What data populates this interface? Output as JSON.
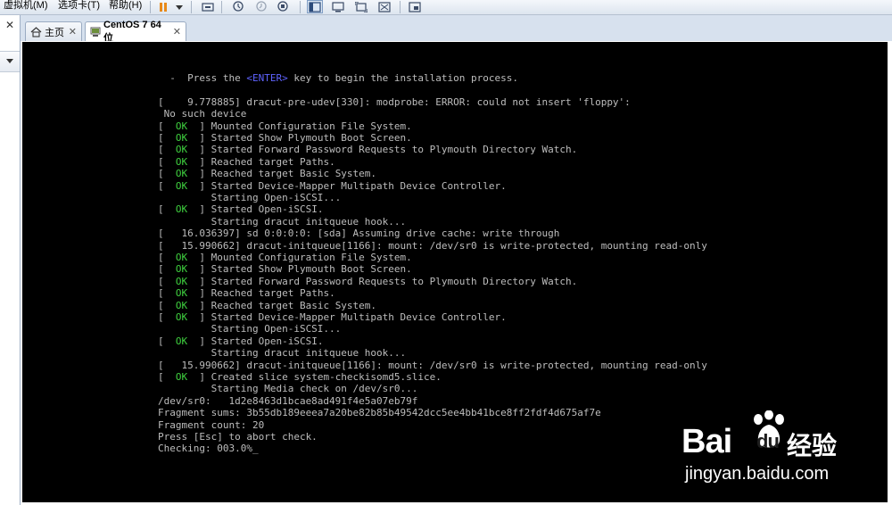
{
  "menu": {
    "items": [
      {
        "label": "虚拟机(M)"
      },
      {
        "label": "选项卡(T)"
      },
      {
        "label": "帮助(H)"
      }
    ]
  },
  "toolbar": {
    "icons": [
      "pause-icon",
      "dropdown-arrow-icon",
      "send-ctrl-alt-del-icon",
      "snapshot-take-icon",
      "snapshot-revert-icon",
      "snapshot-manager-icon",
      "view-sidebar-icon",
      "view-console-icon",
      "fullscreen-icon",
      "unity-icon",
      "thumbnail-icon"
    ]
  },
  "left_panel": {
    "close_glyph": "✕"
  },
  "tabs": [
    {
      "label": "主页",
      "icon": "home-icon",
      "close": "✕",
      "active": false
    },
    {
      "label": "CentOS 7 64 位",
      "icon": "vm-icon",
      "close": "✕",
      "active": true
    }
  ],
  "console": {
    "lines": [
      {
        "segments": [
          {
            "t": "  -  Press the "
          },
          {
            "t": "<ENTER>",
            "c": "enter"
          },
          {
            "t": " key to begin the installation process."
          }
        ]
      },
      {
        "segments": [
          {
            "t": ""
          }
        ]
      },
      {
        "segments": [
          {
            "t": "[    9.778885] dracut-pre-udev[330]: modprobe: ERROR: could not insert 'floppy':"
          }
        ]
      },
      {
        "segments": [
          {
            "t": " No such device"
          }
        ]
      },
      {
        "segments": [
          {
            "t": "[  "
          },
          {
            "t": "OK",
            "c": "ok"
          },
          {
            "t": "  ] Mounted Configuration File System."
          }
        ]
      },
      {
        "segments": [
          {
            "t": "[  "
          },
          {
            "t": "OK",
            "c": "ok"
          },
          {
            "t": "  ] Started Show Plymouth Boot Screen."
          }
        ]
      },
      {
        "segments": [
          {
            "t": "[  "
          },
          {
            "t": "OK",
            "c": "ok"
          },
          {
            "t": "  ] Started Forward Password Requests to Plymouth Directory Watch."
          }
        ]
      },
      {
        "segments": [
          {
            "t": "[  "
          },
          {
            "t": "OK",
            "c": "ok"
          },
          {
            "t": "  ] Reached target Paths."
          }
        ]
      },
      {
        "segments": [
          {
            "t": "[  "
          },
          {
            "t": "OK",
            "c": "ok"
          },
          {
            "t": "  ] Reached target Basic System."
          }
        ]
      },
      {
        "segments": [
          {
            "t": "[  "
          },
          {
            "t": "OK",
            "c": "ok"
          },
          {
            "t": "  ] Started Device-Mapper Multipath Device Controller."
          }
        ]
      },
      {
        "segments": [
          {
            "t": "         Starting Open-iSCSI..."
          }
        ]
      },
      {
        "segments": [
          {
            "t": "[  "
          },
          {
            "t": "OK",
            "c": "ok"
          },
          {
            "t": "  ] Started Open-iSCSI."
          }
        ]
      },
      {
        "segments": [
          {
            "t": "         Starting dracut initqueue hook..."
          }
        ]
      },
      {
        "segments": [
          {
            "t": "[   16.036397] sd 0:0:0:0: [sda] Assuming drive cache: write through"
          }
        ]
      },
      {
        "segments": [
          {
            "t": "[   15.990662] dracut-initqueue[1166]: mount: /dev/sr0 is write-protected, mounting read-only"
          }
        ]
      },
      {
        "segments": [
          {
            "t": "[  "
          },
          {
            "t": "OK",
            "c": "ok"
          },
          {
            "t": "  ] Mounted Configuration File System."
          }
        ]
      },
      {
        "segments": [
          {
            "t": "[  "
          },
          {
            "t": "OK",
            "c": "ok"
          },
          {
            "t": "  ] Started Show Plymouth Boot Screen."
          }
        ]
      },
      {
        "segments": [
          {
            "t": "[  "
          },
          {
            "t": "OK",
            "c": "ok"
          },
          {
            "t": "  ] Started Forward Password Requests to Plymouth Directory Watch."
          }
        ]
      },
      {
        "segments": [
          {
            "t": "[  "
          },
          {
            "t": "OK",
            "c": "ok"
          },
          {
            "t": "  ] Reached target Paths."
          }
        ]
      },
      {
        "segments": [
          {
            "t": "[  "
          },
          {
            "t": "OK",
            "c": "ok"
          },
          {
            "t": "  ] Reached target Basic System."
          }
        ]
      },
      {
        "segments": [
          {
            "t": "[  "
          },
          {
            "t": "OK",
            "c": "ok"
          },
          {
            "t": "  ] Started Device-Mapper Multipath Device Controller."
          }
        ]
      },
      {
        "segments": [
          {
            "t": "         Starting Open-iSCSI..."
          }
        ]
      },
      {
        "segments": [
          {
            "t": "[  "
          },
          {
            "t": "OK",
            "c": "ok"
          },
          {
            "t": "  ] Started Open-iSCSI."
          }
        ]
      },
      {
        "segments": [
          {
            "t": "         Starting dracut initqueue hook..."
          }
        ]
      },
      {
        "segments": [
          {
            "t": "[   15.990662] dracut-initqueue[1166]: mount: /dev/sr0 is write-protected, mounting read-only"
          }
        ]
      },
      {
        "segments": [
          {
            "t": "[  "
          },
          {
            "t": "OK",
            "c": "ok"
          },
          {
            "t": "  ] Created slice system-checkisomd5.slice."
          }
        ]
      },
      {
        "segments": [
          {
            "t": "         Starting Media check on /dev/sr0..."
          }
        ]
      },
      {
        "segments": [
          {
            "t": "/dev/sr0:   1d2e8463d1bcae8ad491f4e5a07eb79f"
          }
        ]
      },
      {
        "segments": [
          {
            "t": "Fragment sums: 3b55db189eeea7a20be82b85b49542dcc5ee4bb41bce8ff2fdf4d675af7e"
          }
        ]
      },
      {
        "segments": [
          {
            "t": "Fragment count: 20"
          }
        ]
      },
      {
        "segments": [
          {
            "t": "Press [Esc] to abort check."
          }
        ]
      },
      {
        "segments": [
          {
            "t": "Checking: 003.0%"
          },
          {
            "t": "_",
            "c": "cursor"
          }
        ]
      }
    ]
  },
  "watermark": {
    "logo": "Bai",
    "logo_paw": "du",
    "chinese": "经验",
    "url": "jingyan.baidu.com"
  }
}
